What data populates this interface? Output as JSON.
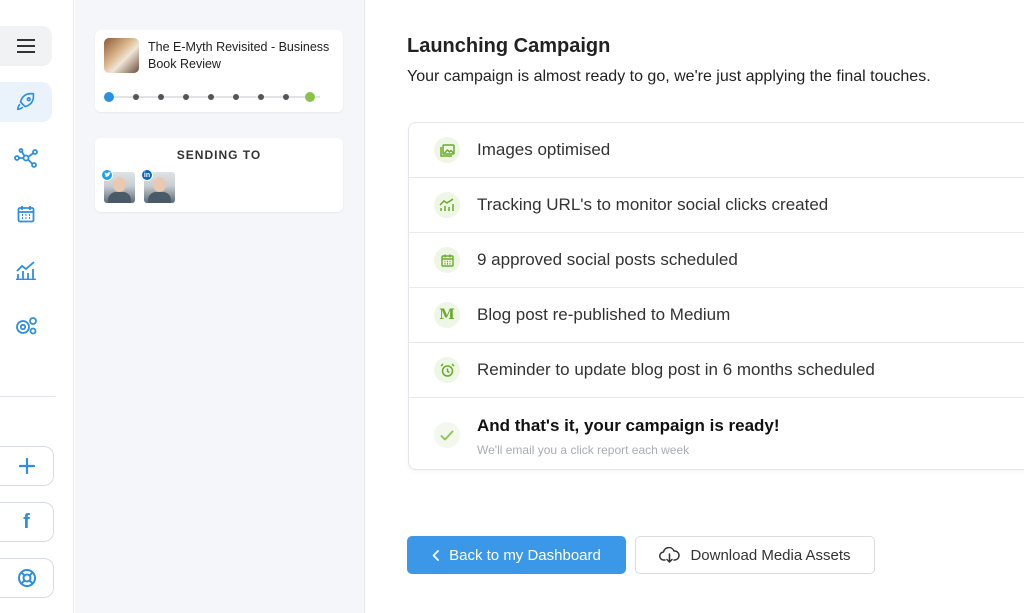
{
  "rail": {
    "icons": [
      "menu-icon",
      "rocket-icon",
      "network-icon",
      "calendar-icon",
      "analytics-icon",
      "settings-icon"
    ],
    "bottom_icons": [
      "plus-icon",
      "facebook-icon",
      "lifebuoy-icon"
    ],
    "facebook_label": "f"
  },
  "campaign": {
    "title": "The E-Myth Revisited - Business Book Review",
    "progress_steps": 9,
    "sending_to_label": "SENDING TO",
    "recipients": [
      {
        "network": "twitter",
        "badge": ""
      },
      {
        "network": "linkedin",
        "badge": "in"
      }
    ]
  },
  "main": {
    "title": "Launching Campaign",
    "subtitle": "Your campaign is almost ready to go, we're just applying the final touches.",
    "steps": [
      {
        "icon": "image-icon",
        "text": "Images optimised"
      },
      {
        "icon": "chart-icon",
        "text": "Tracking URL's to monitor social clicks created"
      },
      {
        "icon": "calendar-icon",
        "text": "9 approved social posts scheduled"
      },
      {
        "icon": "medium-icon",
        "glyph": "M",
        "text": "Blog post re-published to Medium"
      },
      {
        "icon": "alarm-icon",
        "text": "Reminder to update blog post in 6 months scheduled"
      },
      {
        "icon": "check-icon",
        "text": "And that's it, your campaign is ready!",
        "sub": "We'll email you a click report each week"
      }
    ],
    "back_button": "Back to my Dashboard",
    "download_button": "Download Media Assets"
  },
  "colors": {
    "accent": "#3b97e8",
    "success": "#8bc34a",
    "icon_green": "#6aaa2a"
  }
}
